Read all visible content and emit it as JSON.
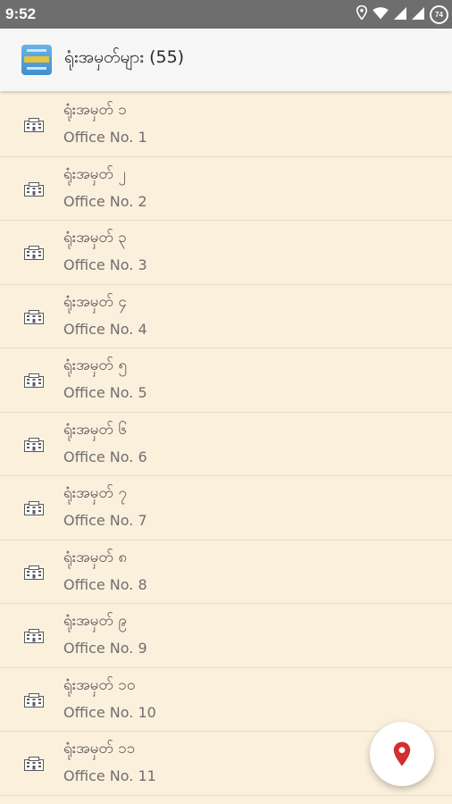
{
  "status_bar": {
    "time": "9:52",
    "battery_level": "74",
    "icons": [
      "location-icon",
      "wifi-icon",
      "signal-icon",
      "signal-icon",
      "battery-icon"
    ]
  },
  "app_bar": {
    "logo_icon": "app-logo-icon",
    "title": "ရုံးအမှတ်များ (55)"
  },
  "offices": [
    {
      "title": "ရုံးအမှတ် ၁",
      "subtitle": "Office No. 1"
    },
    {
      "title": "ရုံးအမှတ် ၂",
      "subtitle": "Office No. 2"
    },
    {
      "title": "ရုံးအမှတ် ၃",
      "subtitle": "Office No. 3"
    },
    {
      "title": "ရုံးအမှတ် ၄",
      "subtitle": "Office No. 4"
    },
    {
      "title": "ရုံးအမှတ် ၅",
      "subtitle": "Office No. 5"
    },
    {
      "title": "ရုံးအမှတ် ၆",
      "subtitle": "Office No. 6"
    },
    {
      "title": "ရုံးအမှတ် ၇",
      "subtitle": "Office No. 7"
    },
    {
      "title": "ရုံးအမှတ် ၈",
      "subtitle": "Office No. 8"
    },
    {
      "title": "ရုံးအမှတ် ၉",
      "subtitle": "Office No. 9"
    },
    {
      "title": "ရုံးအမှတ် ၁၀",
      "subtitle": "Office No. 10"
    },
    {
      "title": "ရုံးအမှတ် ၁၁",
      "subtitle": "Office No. 11"
    }
  ],
  "list_item_icon": "office-building-icon",
  "fab": {
    "icon": "location-pin-icon",
    "color": "#d32f2f"
  },
  "colors": {
    "status_bar": "#6e6e6e",
    "app_bar": "#f6f6f6",
    "list_background": "#fbf0dc",
    "divider": "#e7dcc6"
  }
}
